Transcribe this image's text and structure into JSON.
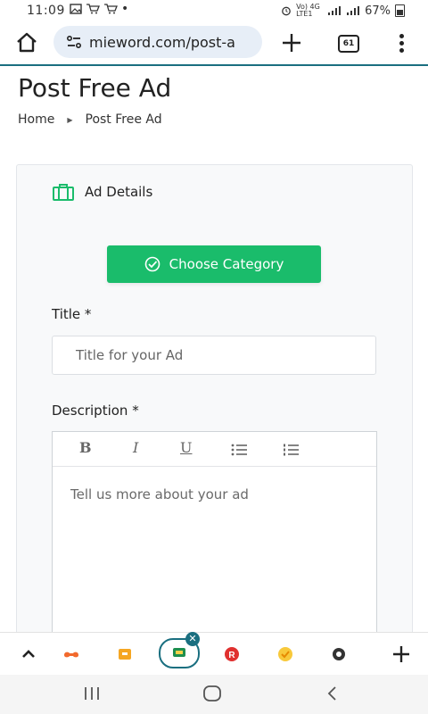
{
  "status_bar": {
    "time": "11:09",
    "network_label": "Vo) 4G LTE1",
    "battery": "67%"
  },
  "browser": {
    "url": "mieword.com/post-a",
    "tab_count": "61"
  },
  "page": {
    "title": "Post Free Ad",
    "breadcrumb": {
      "home": "Home",
      "current": "Post Free Ad"
    }
  },
  "form": {
    "section_title": "Ad Details",
    "choose_category_label": "Choose Category",
    "title_label": "Title *",
    "title_placeholder": "Title for your Ad",
    "description_label": "Description *",
    "description_placeholder": "Tell us more about your ad",
    "editor_toolbar": {
      "bold": "B",
      "italic": "I",
      "underline": "U"
    }
  },
  "icons": {
    "home": "home-icon",
    "site_settings": "site-settings-icon",
    "new_tab": "plus-icon",
    "tabs": "tabs-counter-icon",
    "menu": "more-vert-icon",
    "briefcase": "briefcase-icon",
    "check": "check-circle-icon"
  },
  "colors": {
    "accent_green": "#1abc6b",
    "toolbar_underline": "#1a6f80"
  }
}
